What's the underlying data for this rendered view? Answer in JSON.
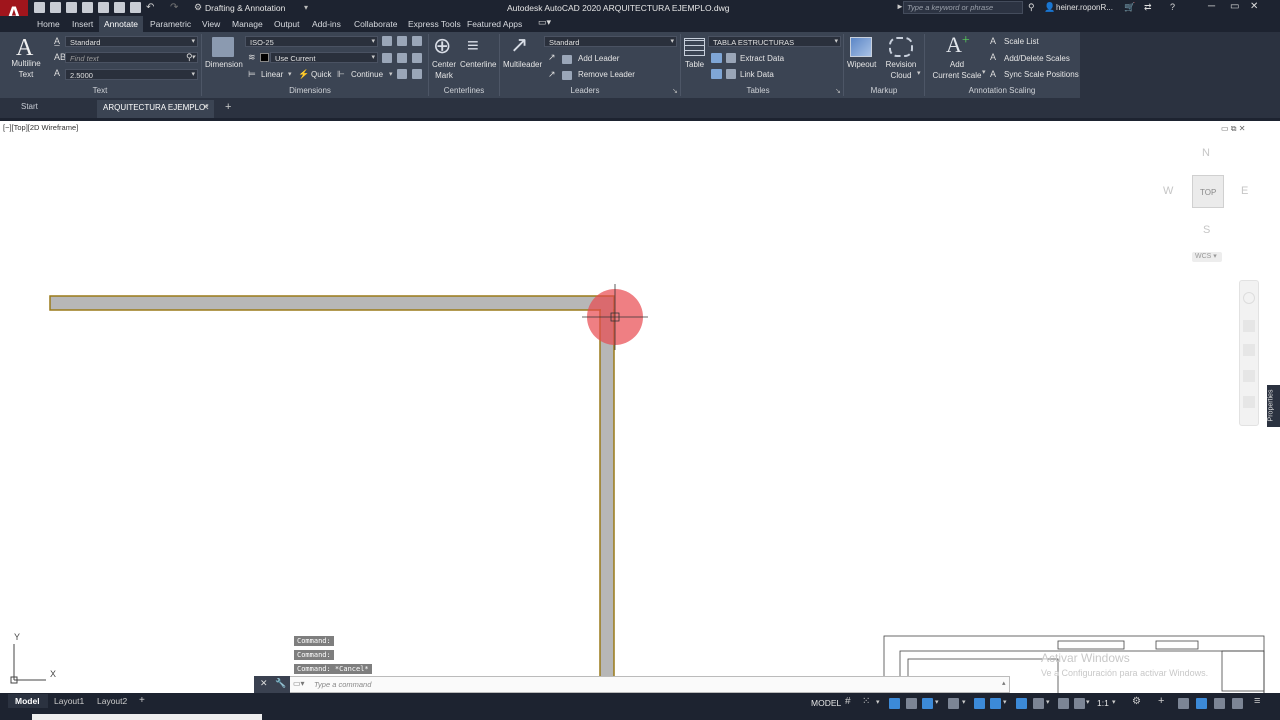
{
  "app": {
    "title": "Autodesk AutoCAD 2020   ARQUITECTURA EJEMPLO.dwg",
    "logo": "A",
    "workspace": "Drafting & Annotation",
    "search_placeholder": "Type a keyword or phrase",
    "user": "heiner.roponR..."
  },
  "menu": {
    "tabs": [
      "Home",
      "Insert",
      "Annotate",
      "Parametric",
      "View",
      "Manage",
      "Output",
      "Add-ins",
      "Collaborate",
      "Express Tools",
      "Featured Apps"
    ],
    "active": "Annotate"
  },
  "ribbon": {
    "text": {
      "big_button": [
        "Multiline",
        "Text"
      ],
      "style": "Standard",
      "find_placeholder": "Find text",
      "height": "2.5000",
      "panel": "Text"
    },
    "dimensions": {
      "big_button": "Dimension",
      "style": "ISO-25",
      "layer": "Use Current",
      "linear": "Linear",
      "quick": "Quick",
      "continue": "Continue",
      "panel": "Dimensions"
    },
    "centerlines": {
      "center_mark": [
        "Center",
        "Mark"
      ],
      "centerline": "Centerline",
      "panel": "Centerlines"
    },
    "leaders": {
      "big_button": "Multileader",
      "style": "Standard",
      "add": "Add Leader",
      "remove": "Remove Leader",
      "panel": "Leaders"
    },
    "tables": {
      "big_button": "Table",
      "style": "TABLA ESTRUCTURAS",
      "extract": "Extract Data",
      "link": "Link Data",
      "panel": "Tables"
    },
    "markup": {
      "wipeout": "Wipeout",
      "revision_cloud": [
        "Revision",
        "Cloud"
      ],
      "panel": "Markup"
    },
    "annotation_scaling": {
      "add_scale": [
        "Add",
        "Current Scale"
      ],
      "scale_list": "Scale List",
      "add_delete": "Add/Delete Scales",
      "sync": "Sync Scale Positions",
      "panel": "Annotation Scaling"
    }
  },
  "file_tabs": {
    "start": "Start",
    "active": "ARQUITECTURA EJEMPLO*"
  },
  "viewport": {
    "label": "[−][Top][2D Wireframe]",
    "viewcube": {
      "n": "N",
      "s": "S",
      "e": "E",
      "w": "W",
      "top": "TOP",
      "wcs": "WCS ▾"
    },
    "ucs": {
      "x": "X",
      "y": "Y"
    },
    "properties_tab": "Properties"
  },
  "command": {
    "history": [
      "Command:",
      "Command:",
      "Command: *Cancel*"
    ],
    "placeholder": "Type a command"
  },
  "watermark": {
    "line1": "Activar Windows",
    "line2": "Ve a Configuración para activar Windows."
  },
  "status": {
    "model_tab": "Model",
    "layouts": [
      "Layout1",
      "Layout2"
    ],
    "model_space": "MODEL",
    "scale": "1:1"
  },
  "colors": {
    "wall_fill": "#b7b7b7",
    "wall_edge": "#9a7a18",
    "cursor_highlight": "#e8484f",
    "ribbon_bg": "#3b4453",
    "title_bg": "#1d2330"
  }
}
